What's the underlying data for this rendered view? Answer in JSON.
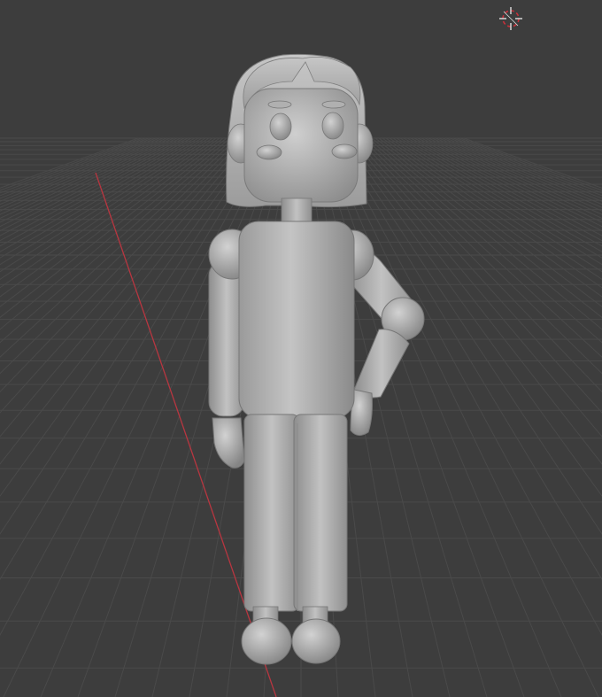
{
  "viewport": {
    "background_color": "#3d3d3d",
    "grid_line_color": "#4a4a4a",
    "grid_line_dark_color": "#353535",
    "axis_x_color": "#b83640",
    "model_base_color": "#b4b4b4",
    "model_highlight_color": "#cfcfcf",
    "model_shadow_color": "#7a7a7a",
    "cursor_color_primary": "#e0e0e0",
    "cursor_color_secondary": "#c8303a"
  },
  "scene": {
    "object_kind": "character-mesh",
    "shading": "solid",
    "has_floor_grid": true,
    "has_3d_cursor": true,
    "has_axis_line": true
  },
  "icons": {
    "cursor": "3d-cursor-icon"
  }
}
